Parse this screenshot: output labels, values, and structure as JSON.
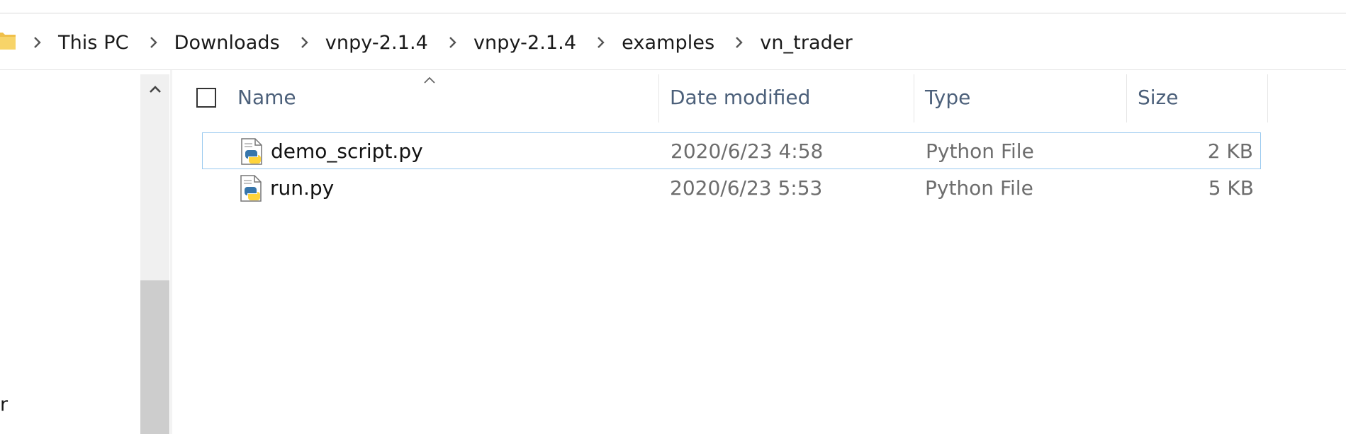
{
  "breadcrumb": {
    "items": [
      "This PC",
      "Downloads",
      "vnpy-2.1.4",
      "vnpy-2.1.4",
      "examples",
      "vn_trader"
    ]
  },
  "nav_pane": {
    "partial_text": "r"
  },
  "columns": {
    "name": "Name",
    "date_modified": "Date modified",
    "type": "Type",
    "size": "Size"
  },
  "files": [
    {
      "name": "demo_script.py",
      "date": "2020/6/23 4:58",
      "type": "Python File",
      "size": "2 KB"
    },
    {
      "name": "run.py",
      "date": "2020/6/23 5:53",
      "type": "Python File",
      "size": "5 KB"
    }
  ],
  "icons": {
    "folder": "folder-icon",
    "separator": "chevron-right-icon",
    "sort": "sort-ascending-icon",
    "scroll_up": "chevron-up-icon",
    "python_file": "python-file-icon"
  },
  "colors": {
    "header_text": "#4c607a",
    "secondary_text": "#6d6d6d",
    "selection_border": "#99c9ef",
    "folder_yellow": "#f5c542"
  }
}
